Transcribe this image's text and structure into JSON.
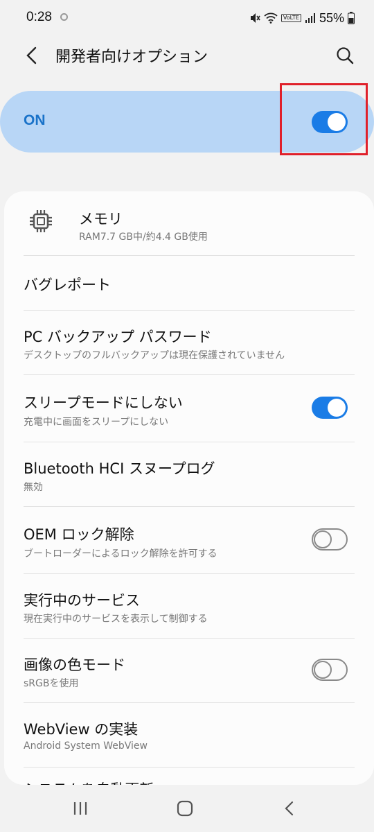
{
  "status_bar": {
    "time": "0:28",
    "battery": "55%",
    "network_badge": "VoLTE"
  },
  "header": {
    "title": "開発者向けオプション",
    "back_icon": "chevron-left-icon",
    "search_icon": "search-icon"
  },
  "master_switch": {
    "label": "ON",
    "checked": true
  },
  "items": [
    {
      "title": "メモリ",
      "subtitle": "RAM7.7 GB中/約4.4 GB使用",
      "icon": "memory-chip-icon"
    },
    {
      "title": "バグレポート"
    },
    {
      "title": "PC バックアップ パスワード",
      "subtitle": "デスクトップのフルバックアップは現在保護されていません"
    },
    {
      "title": "スリープモードにしない",
      "subtitle": "充電中に画面をスリープにしない",
      "toggle": true
    },
    {
      "title": "Bluetooth HCI スヌープログ",
      "subtitle": "無効"
    },
    {
      "title": "OEM ロック解除",
      "subtitle": "ブートローダーによるロック解除を許可する",
      "toggle": false
    },
    {
      "title": "実行中のサービス",
      "subtitle": "現在実行中のサービスを表示して制御する"
    },
    {
      "title": "画像の色モード",
      "subtitle": "sRGBを使用",
      "toggle": false
    },
    {
      "title": "WebView の実装",
      "subtitle": "Android System WebView"
    },
    {
      "title": "システムを自動更新"
    }
  ],
  "nav_bar": {
    "recents_icon": "recent-apps-icon",
    "home_icon": "home-icon",
    "back_icon": "back-icon"
  },
  "colors": {
    "accent": "#1a7ce6",
    "master_bg": "#b8d6f6",
    "master_text": "#1a73c9",
    "highlight": "#e0202a"
  }
}
